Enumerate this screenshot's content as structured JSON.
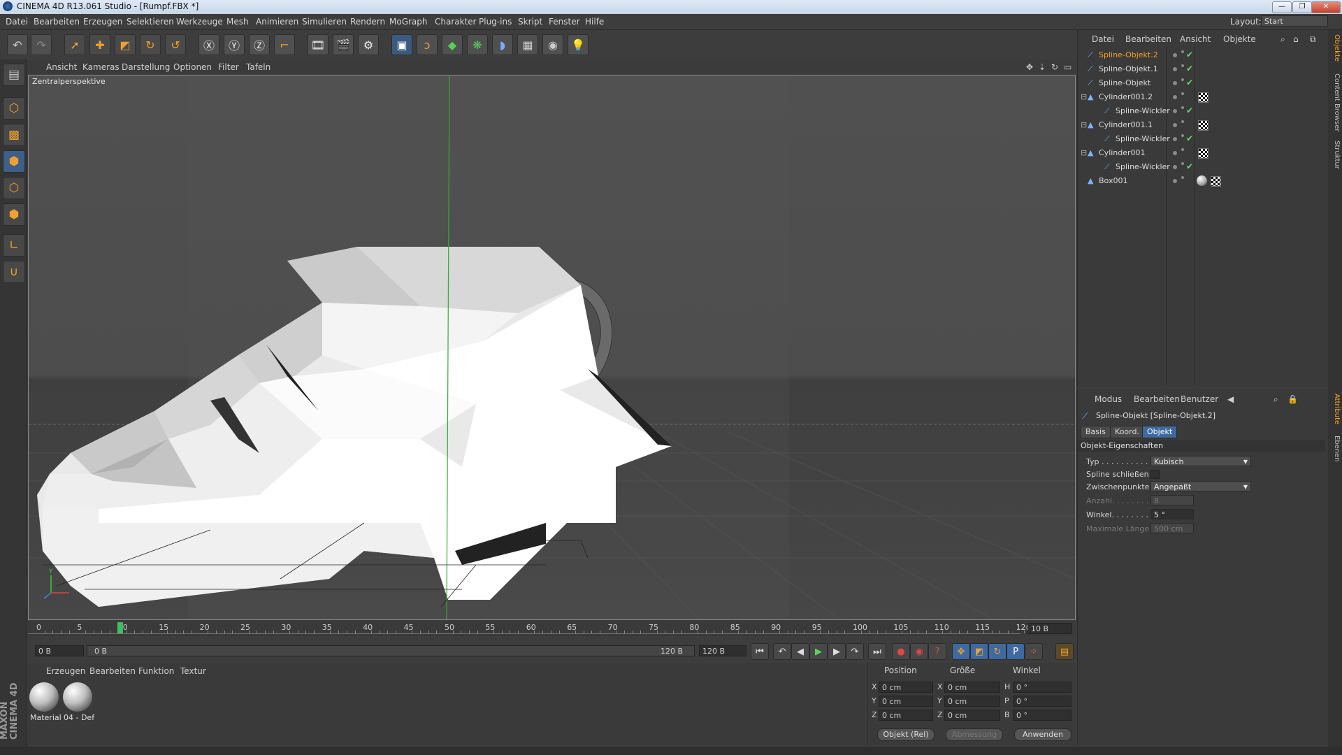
{
  "window": {
    "title": "CINEMA 4D R13.061 Studio - [Rumpf.FBX *]",
    "min": "—",
    "max": "❐",
    "close": "✕"
  },
  "menu": [
    "Datei",
    "Bearbeiten",
    "Erzeugen",
    "Selektieren",
    "Werkzeuge",
    "Mesh",
    "Animieren",
    "Simulieren",
    "Rendern",
    "MoGraph",
    "Charakter",
    "Plug-ins",
    "Skript",
    "Fenster",
    "Hilfe"
  ],
  "layout": {
    "label": "Layout:",
    "value": "Start"
  },
  "viewport": {
    "menu": [
      "Ansicht",
      "Kameras",
      "Darstellung",
      "Optionen",
      "Filter",
      "Tafeln"
    ],
    "camera_label": "Zentralperspektive"
  },
  "timeline": {
    "ticks": [
      "0",
      "5",
      "10",
      "15",
      "20",
      "25",
      "30",
      "35",
      "40",
      "45",
      "50",
      "55",
      "60",
      "65",
      "70",
      "75",
      "80",
      "85",
      "90",
      "95",
      "100",
      "105",
      "110",
      "115",
      "12("
    ],
    "current_frame": 10,
    "end_field": "10 B"
  },
  "transport": {
    "start": "0 B",
    "range_start": "0 B",
    "range_end": "120 B",
    "end": "120 B"
  },
  "material_manager": {
    "menu": [
      "Erzeugen",
      "Bearbeiten",
      "Funktion",
      "Textur"
    ],
    "materials": [
      "Material",
      "04 - Def"
    ]
  },
  "coordinates": {
    "headers": [
      "Position",
      "Größe",
      "Winkel"
    ],
    "rows": [
      {
        "axis": "X",
        "pos": "0 cm",
        "size_axis": "X",
        "size": "0 cm",
        "rot_axis": "H",
        "rot": "0 °"
      },
      {
        "axis": "Y",
        "pos": "0 cm",
        "size_axis": "Y",
        "size": "0 cm",
        "rot_axis": "P",
        "rot": "0 °"
      },
      {
        "axis": "Z",
        "pos": "0 cm",
        "size_axis": "Z",
        "size": "0 cm",
        "rot_axis": "B",
        "rot": "0 °"
      }
    ],
    "mode": "Objekt (Rel)",
    "size_mode": "Abmessung",
    "apply": "Anwenden"
  },
  "object_manager": {
    "menu": [
      "Datei",
      "Bearbeiten",
      "Ansicht",
      "Objekte"
    ],
    "objects": [
      {
        "name": "Spline-Objekt.2",
        "selected": true
      },
      {
        "name": "Spline-Objekt.1",
        "selected": false
      },
      {
        "name": "Spline-Objekt",
        "selected": false
      },
      {
        "name": "Cylinder001.2",
        "selected": false
      },
      {
        "name": "Spline-Wickler",
        "selected": false
      },
      {
        "name": "Cylinder001.1",
        "selected": false
      },
      {
        "name": "Spline-Wickler",
        "selected": false
      },
      {
        "name": "Cylinder001",
        "selected": false
      },
      {
        "name": "Spline-Wickler",
        "selected": false
      },
      {
        "name": "Box001",
        "selected": false
      }
    ]
  },
  "attribute_manager": {
    "menu": [
      "Modus",
      "Bearbeiten",
      "Benutzer"
    ],
    "object_title": "Spline-Objekt [Spline-Objekt.2]",
    "tabs": [
      "Basis",
      "Koord.",
      "Objekt"
    ],
    "active_tab": "Objekt",
    "section": "Objekt-Eigenschaften",
    "props": {
      "typ_label": "Typ . . . . . . . . . .",
      "typ_value": "Kubisch",
      "close_label": "Spline schließen",
      "inter_label": "Zwischenpunkte",
      "inter_value": "Angepaßt",
      "anzahl_label": "Anzahl. . . . . . . .",
      "anzahl_value": "8",
      "winkel_label": "Winkel. . . . . . . .",
      "winkel_value": "5 °",
      "maxlen_label": "Maximale Länge",
      "maxlen_value": "500 cm"
    }
  },
  "right_tabs": [
    "Objekte",
    "Content Browser",
    "Struktur",
    "Attribute",
    "Ebenen"
  ],
  "branding": "MAXON CINEMA 4D"
}
